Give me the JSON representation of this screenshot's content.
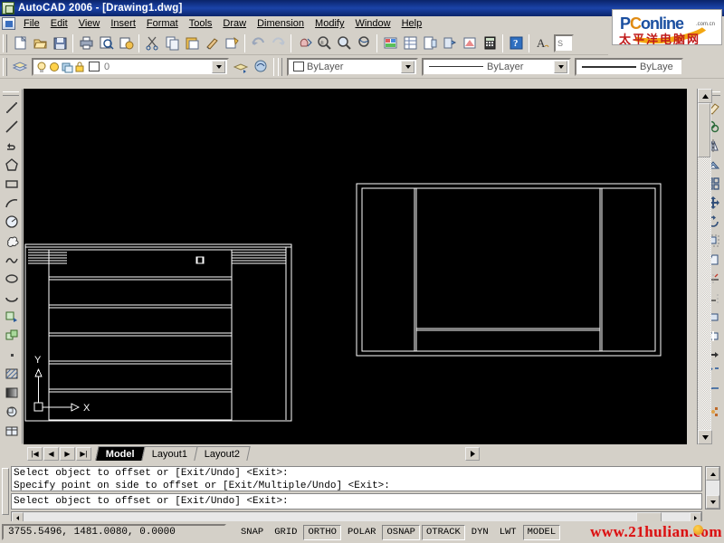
{
  "window": {
    "title": "AutoCAD 2006 - [Drawing1.dwg]",
    "app_icon": "autocad-icon",
    "document_icon": "document-icon"
  },
  "menu": {
    "items": [
      {
        "label": "File",
        "mnemonic": "F"
      },
      {
        "label": "Edit",
        "mnemonic": "E"
      },
      {
        "label": "View",
        "mnemonic": "V"
      },
      {
        "label": "Insert",
        "mnemonic": "I"
      },
      {
        "label": "Format",
        "mnemonic": "o"
      },
      {
        "label": "Tools",
        "mnemonic": "T"
      },
      {
        "label": "Draw",
        "mnemonic": "D"
      },
      {
        "label": "Dimension",
        "mnemonic": "n"
      },
      {
        "label": "Modify",
        "mnemonic": "M"
      },
      {
        "label": "Window",
        "mnemonic": "W"
      },
      {
        "label": "Help",
        "mnemonic": "H"
      }
    ]
  },
  "logo": {
    "brand_main": "P",
    "brand_o": "C",
    "brand_rest": "online",
    "tld": ".com.cn",
    "chinese": "太平洋电脑网",
    "accent_color": "#1b4fa0",
    "accent_orange": "#e08b14",
    "chinese_color": "#c01a1a"
  },
  "standard_toolbar": {
    "buttons": [
      {
        "name": "new-icon",
        "tip": "QNew"
      },
      {
        "name": "open-icon",
        "tip": "Open"
      },
      {
        "name": "save-icon",
        "tip": "Save"
      },
      {
        "name": "plot-icon",
        "tip": "Plot"
      },
      {
        "name": "plot-preview-icon",
        "tip": "Plot Preview"
      },
      {
        "name": "publish-icon",
        "tip": "Publish"
      },
      {
        "name": "cut-icon",
        "tip": "Cut"
      },
      {
        "name": "copy-icon",
        "tip": "Copy"
      },
      {
        "name": "paste-icon",
        "tip": "Paste"
      },
      {
        "name": "match-properties-icon",
        "tip": "Match Properties"
      },
      {
        "name": "block-editor-icon",
        "tip": "Block Editor"
      },
      {
        "name": "undo-icon",
        "tip": "Undo"
      },
      {
        "name": "redo-icon",
        "tip": "Redo"
      },
      {
        "name": "pan-realtime-icon",
        "tip": "Pan Realtime"
      },
      {
        "name": "zoom-realtime-icon",
        "tip": "Zoom Realtime"
      },
      {
        "name": "zoom-window-icon",
        "tip": "Zoom Window"
      },
      {
        "name": "zoom-previous-icon",
        "tip": "Zoom Previous"
      },
      {
        "name": "properties-icon",
        "tip": "Properties"
      },
      {
        "name": "design-center-icon",
        "tip": "DesignCenter"
      },
      {
        "name": "tool-palettes-icon",
        "tip": "Tool Palettes"
      },
      {
        "name": "sheet-set-icon",
        "tip": "Sheet Set Manager"
      },
      {
        "name": "markup-set-icon",
        "tip": "Markup Set Manager"
      },
      {
        "name": "calculator-icon",
        "tip": "QuickCalc"
      },
      {
        "name": "help-icon",
        "tip": "Help"
      },
      {
        "name": "text-style-icon",
        "tip": "Text Style"
      }
    ]
  },
  "layer_toolbar": {
    "layer_prop_icon": "layer-properties-icon",
    "state_icons": [
      "lightbulb-icon",
      "sun-icon",
      "freeze-icon",
      "lock-icon"
    ],
    "layer_swatch_color": "#ffffff",
    "current_layer": "0",
    "layer_previous_icon": "layer-previous-icon",
    "layer_states_icon": "layer-states-icon"
  },
  "properties_toolbar": {
    "color": {
      "value": "ByLayer",
      "swatch": "#ffffff"
    },
    "linetype": {
      "value": "ByLayer"
    },
    "lineweight": {
      "value": "ByLayer"
    },
    "partial": {
      "value": "ByLaye"
    }
  },
  "draw_toolbar": {
    "buttons": [
      {
        "name": "line-icon"
      },
      {
        "name": "construction-line-icon"
      },
      {
        "name": "polyline-icon"
      },
      {
        "name": "polygon-icon"
      },
      {
        "name": "rectangle-icon"
      },
      {
        "name": "arc-icon"
      },
      {
        "name": "circle-icon"
      },
      {
        "name": "revision-cloud-icon"
      },
      {
        "name": "spline-icon"
      },
      {
        "name": "ellipse-icon"
      },
      {
        "name": "ellipse-arc-icon"
      },
      {
        "name": "insert-block-icon"
      },
      {
        "name": "make-block-icon"
      },
      {
        "name": "point-icon"
      },
      {
        "name": "hatch-icon"
      },
      {
        "name": "gradient-icon"
      },
      {
        "name": "region-icon"
      },
      {
        "name": "table-icon"
      }
    ]
  },
  "modify_toolbar": {
    "buttons": [
      {
        "name": "erase-icon"
      },
      {
        "name": "copy-object-icon"
      },
      {
        "name": "mirror-icon"
      },
      {
        "name": "offset-icon"
      },
      {
        "name": "array-icon"
      },
      {
        "name": "move-icon"
      },
      {
        "name": "rotate-icon"
      },
      {
        "name": "scale-icon"
      },
      {
        "name": "stretch-icon"
      },
      {
        "name": "trim-icon"
      },
      {
        "name": "extend-icon"
      },
      {
        "name": "break-at-point-icon"
      },
      {
        "name": "break-icon"
      },
      {
        "name": "join-icon"
      },
      {
        "name": "chamfer-icon"
      },
      {
        "name": "fillet-icon"
      },
      {
        "name": "explode-icon"
      }
    ]
  },
  "drawing": {
    "ucs_x_label": "X",
    "ucs_y_label": "Y",
    "stroke_color": "#ffffff",
    "background": "#000000"
  },
  "layout_tabs": {
    "nav_first": "|◀",
    "nav_prev": "◀",
    "nav_next": "▶",
    "nav_last": "▶|",
    "tabs": [
      {
        "label": "Model",
        "active": true
      },
      {
        "label": "Layout1",
        "active": false
      },
      {
        "label": "Layout2",
        "active": false
      }
    ]
  },
  "command_window": {
    "history": [
      "Select object to offset or [Exit/Undo] <Exit>:",
      "Specify point on side to offset or [Exit/Multiple/Undo] <Exit>:"
    ],
    "current": "Select object to offset or [Exit/Undo] <Exit>:"
  },
  "status_bar": {
    "coordinates": "3755.5496, 1481.0080, 0.0000",
    "toggles": [
      {
        "label": "SNAP",
        "on": false
      },
      {
        "label": "GRID",
        "on": false
      },
      {
        "label": "ORTHO",
        "on": true
      },
      {
        "label": "POLAR",
        "on": false
      },
      {
        "label": "OSNAP",
        "on": true
      },
      {
        "label": "OTRACK",
        "on": true
      },
      {
        "label": "DYN",
        "on": false
      },
      {
        "label": "LWT",
        "on": false
      },
      {
        "label": "MODEL",
        "on": true
      }
    ]
  },
  "watermark": {
    "text": "www.21hulian.com",
    "color": "#d81212"
  }
}
